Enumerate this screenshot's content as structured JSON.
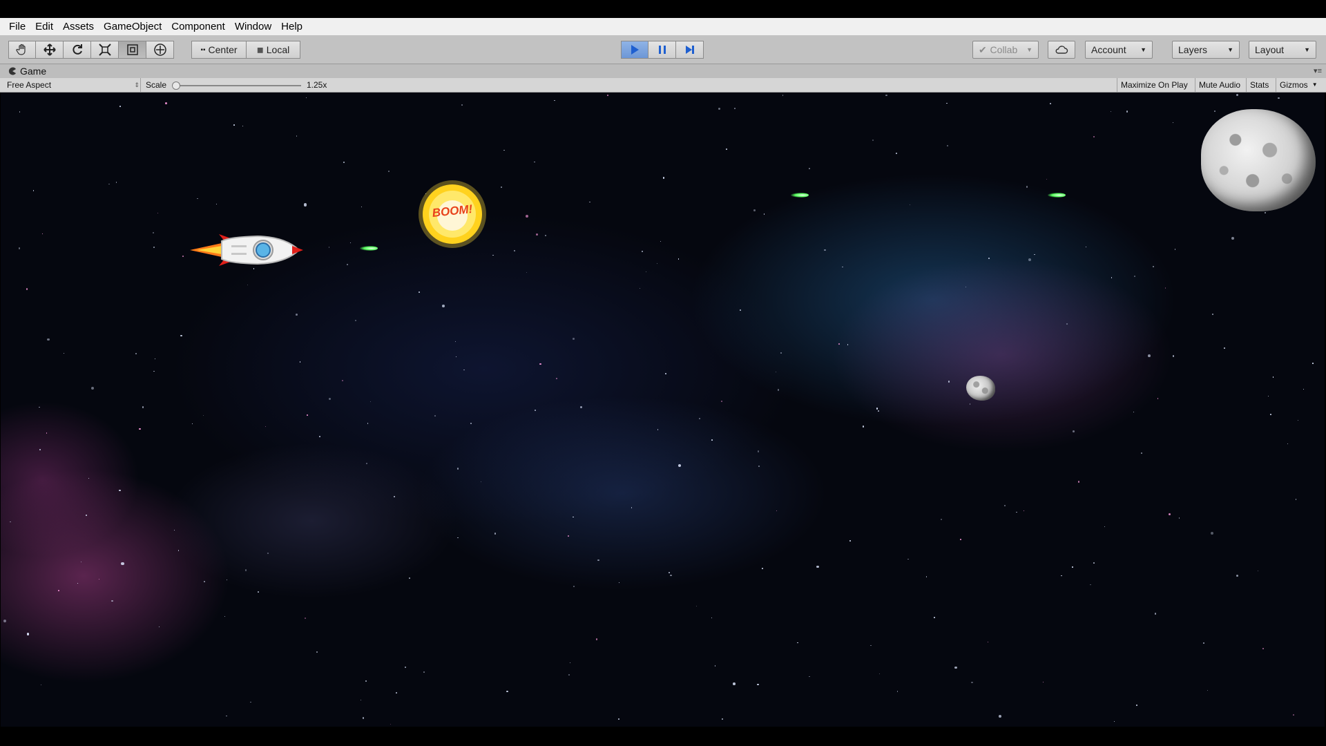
{
  "menubar": {
    "items": [
      "File",
      "Edit",
      "Assets",
      "GameObject",
      "Component",
      "Window",
      "Help"
    ]
  },
  "toolbar": {
    "tools": [
      "hand-tool",
      "move-tool",
      "rotate-tool",
      "scale-tool",
      "rect-tool",
      "transform-tool"
    ],
    "active_tool": "rect-tool",
    "pivot_label": "Center",
    "space_label": "Local",
    "collab_label": "Collab",
    "account_label": "Account",
    "layers_label": "Layers",
    "layout_label": "Layout"
  },
  "game_tab": {
    "title": "Game"
  },
  "game_bar": {
    "aspect": "Free Aspect",
    "scale_label": "Scale",
    "scale_value": "1.25x",
    "maximize_label": "Maximize On Play",
    "mute_label": "Mute Audio",
    "stats_label": "Stats",
    "gizmos_label": "Gizmos"
  },
  "game": {
    "explosion_text": "BOOM!"
  },
  "colors": {
    "play_active": "#6d97d6",
    "laser": "#56ff5c",
    "menubar_bg": "#f0f0f0",
    "toolbar_bg": "#c2c2c2"
  }
}
